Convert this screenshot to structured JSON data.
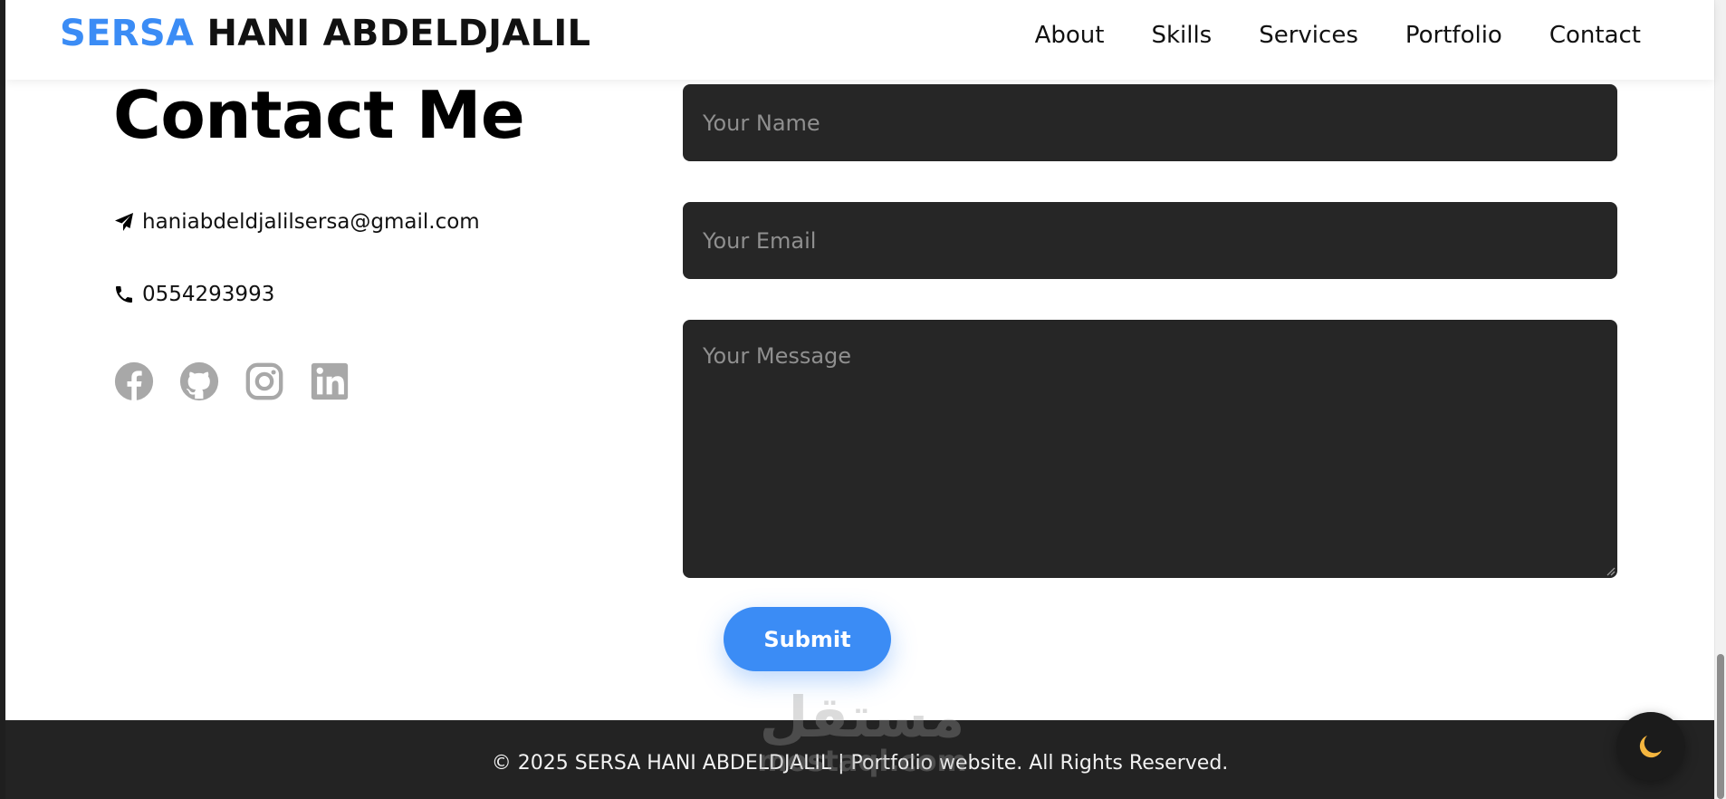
{
  "navbar": {
    "brand_first": "SERSA",
    "brand_rest": "HANI ABDELDJALIL",
    "links": [
      "About",
      "Skills",
      "Services",
      "Portfolio",
      "Contact"
    ]
  },
  "contact": {
    "title": "Contact Me",
    "email": "haniabdeldjalilsersa@gmail.com",
    "phone": "0554293993",
    "socials": [
      "facebook-icon",
      "github-icon",
      "instagram-icon",
      "linkedin-icon"
    ]
  },
  "form": {
    "name_placeholder": "Your Name",
    "email_placeholder": "Your Email",
    "message_placeholder": "Your Message",
    "submit_label": "Submit"
  },
  "footer": {
    "text": "© 2025 SERSA HANI ABDELDJALIL | Portfolio website. All Rights Reserved."
  },
  "watermark": {
    "arabic": "مستقل",
    "latin": "mostaql.com"
  },
  "theme_toggle": {
    "icon": "moon-icon"
  },
  "colors": {
    "accent": "#3b8cf5",
    "field_bg": "#262626",
    "footer_bg": "#232323",
    "social_icon": "#a8a8a8",
    "moon": "#f5b63f"
  }
}
